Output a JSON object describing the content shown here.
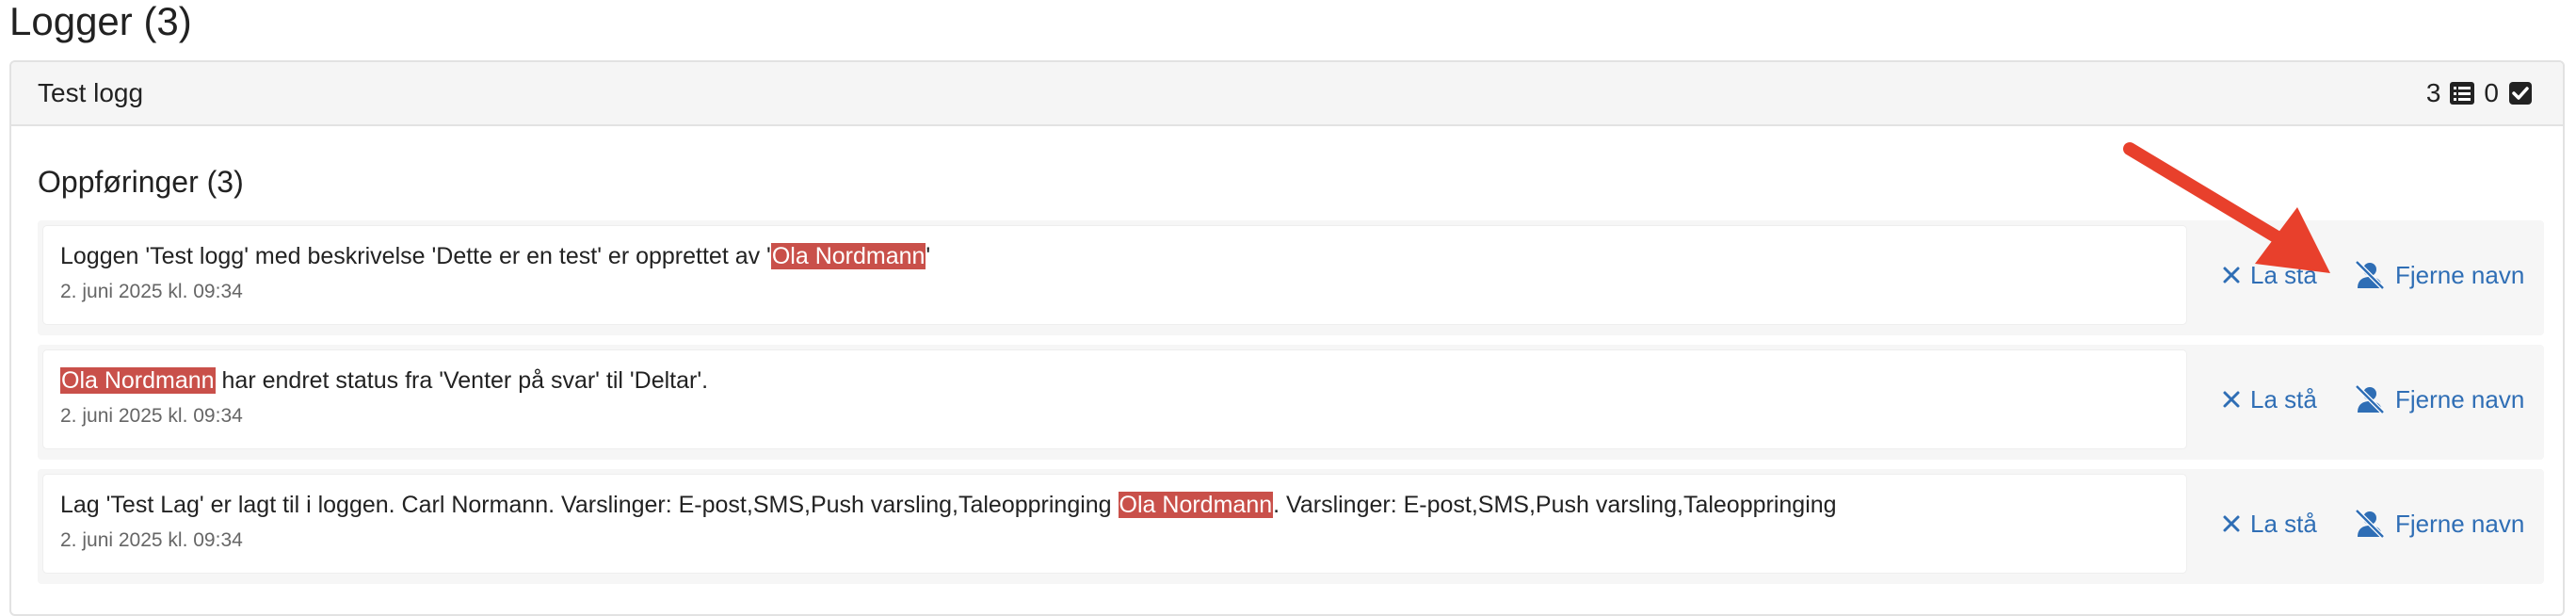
{
  "page": {
    "title": "Logger (3)"
  },
  "log_card": {
    "title": "Test logg",
    "entry_count": "3",
    "checked_count": "0",
    "section_title": "Oppføringer (3)"
  },
  "entries": [
    {
      "before": "Loggen 'Test logg' med beskrivelse 'Dette er en test' er opprettet av '",
      "name": "Ola Nordmann",
      "after": "'",
      "date": "2. juni 2025 kl. 09:34",
      "leave_label": "La stå",
      "remove_label": "Fjerne navn"
    },
    {
      "before": "",
      "name": "Ola Nordmann",
      "after": " har endret status fra 'Venter på svar' til 'Deltar'.",
      "date": "2. juni 2025 kl. 09:34",
      "leave_label": "La stå",
      "remove_label": "Fjerne navn"
    },
    {
      "before": "Lag 'Test Lag' er lagt til i loggen. Carl Normann. Varslinger: E-post,SMS,Push varsling,Taleoppringing ",
      "name": "Ola Nordmann",
      "after": ". Varslinger: E-post,SMS,Push varsling,Taleoppringing",
      "date": "2. juni 2025 kl. 09:34",
      "leave_label": "La stå",
      "remove_label": "Fjerne navn"
    }
  ],
  "colors": {
    "link": "#2f6eb5",
    "highlight": "#c9504a",
    "annotation_arrow": "#e8402c"
  },
  "icons": {
    "list": "list-icon",
    "checkbox": "check-square-icon",
    "leave": "close-icon",
    "remove": "user-slash-icon"
  }
}
